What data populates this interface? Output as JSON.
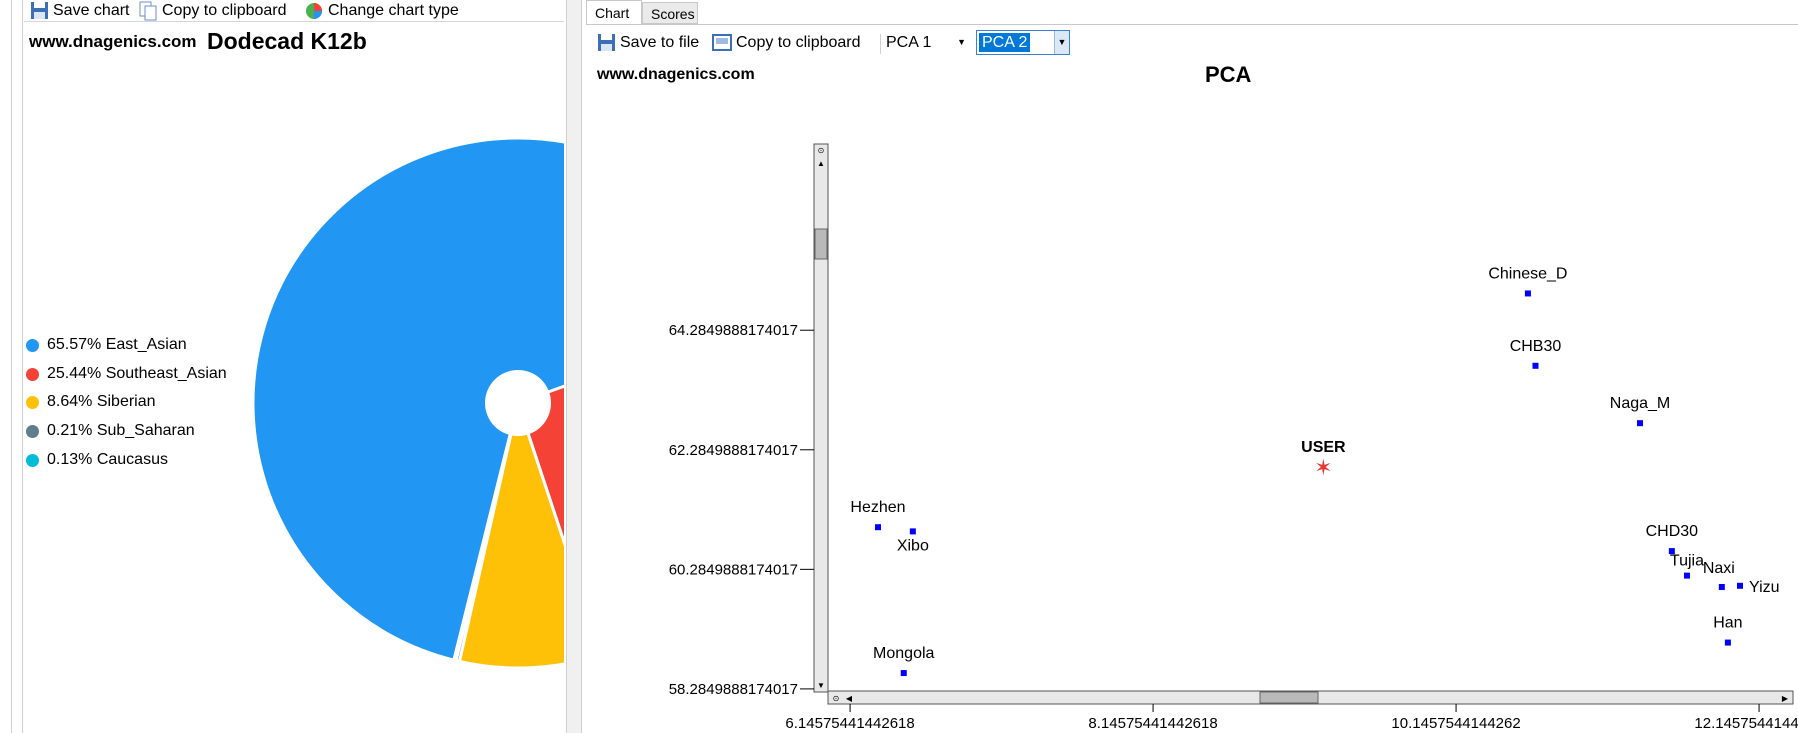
{
  "left_toolbar": {
    "save_chart": "Save chart",
    "copy_clipboard": "Copy to clipboard",
    "change_chart_type": "Change chart type"
  },
  "pie_chart": {
    "site": "www.dnagenics.com",
    "title": "Dodecad K12b"
  },
  "legend": [
    {
      "label": "65.57% East_Asian",
      "color": "#2196f3"
    },
    {
      "label": "25.44% Southeast_Asian",
      "color": "#f44336"
    },
    {
      "label": "8.64% Siberian",
      "color": "#ffc107"
    },
    {
      "label": "0.21% Sub_Saharan",
      "color": "#607d8b"
    },
    {
      "label": "0.13% Caucasus",
      "color": "#00bcd4"
    }
  ],
  "tabs": {
    "chart": "Chart",
    "scores": "Scores"
  },
  "right_toolbar": {
    "save_file": "Save to file",
    "copy_clipboard": "Copy to clipboard",
    "x_axis_select": "PCA 1",
    "y_axis_select": "PCA 2"
  },
  "scatter": {
    "site": "www.dnagenics.com",
    "title": "PCA"
  },
  "chart_data": [
    {
      "type": "pie",
      "title": "Dodecad K12b",
      "categories": [
        "East_Asian",
        "Southeast_Asian",
        "Siberian",
        "Sub_Saharan",
        "Caucasus"
      ],
      "values": [
        65.57,
        25.44,
        8.64,
        0.21,
        0.13
      ],
      "colors": [
        "#2196f3",
        "#f44336",
        "#ffc107",
        "#607d8b",
        "#00bcd4"
      ],
      "legend": "left"
    },
    {
      "type": "scatter",
      "title": "PCA",
      "xlabel": "",
      "ylabel": "",
      "x_ticks": [
        "6.14575441442618",
        "8.14575441442618",
        "10.1457544144262",
        "12.1457544144262"
      ],
      "y_ticks": [
        "64.2849888174017",
        "62.2849888174017",
        "60.2849888174017",
        "58.2849888174017"
      ],
      "xlim": [
        6.0,
        12.35
      ],
      "ylim": [
        58.25,
        67.4
      ],
      "grid": false,
      "points": [
        {
          "label": "Chinese_D",
          "x": 10.62,
          "y": 64.9,
          "color": "#0000ff"
        },
        {
          "label": "CHB30",
          "x": 10.67,
          "y": 63.69,
          "color": "#0000ff"
        },
        {
          "label": "Naga_M",
          "x": 11.36,
          "y": 62.73,
          "color": "#0000ff"
        },
        {
          "label": "USER",
          "x": 9.27,
          "y": 62.0,
          "color": "#e53935",
          "marker": "star",
          "bold": true
        },
        {
          "label": "Hezhen",
          "x": 6.33,
          "y": 60.99,
          "color": "#0000ff"
        },
        {
          "label": "Xibo",
          "x": 6.56,
          "y": 60.92,
          "color": "#0000ff"
        },
        {
          "label": "CHD30",
          "x": 11.57,
          "y": 60.59,
          "color": "#0000ff"
        },
        {
          "label": "Tujia",
          "x": 11.67,
          "y": 60.18,
          "color": "#0000ff"
        },
        {
          "label": "Naxi",
          "x": 11.9,
          "y": 59.99,
          "color": "#0000ff"
        },
        {
          "label": "Yizu",
          "x": 12.02,
          "y": 60.01,
          "color": "#0000ff"
        },
        {
          "label": "Han",
          "x": 11.94,
          "y": 59.06,
          "color": "#0000ff"
        },
        {
          "label": "Mongola",
          "x": 6.5,
          "y": 58.55,
          "color": "#0000ff"
        }
      ]
    }
  ]
}
